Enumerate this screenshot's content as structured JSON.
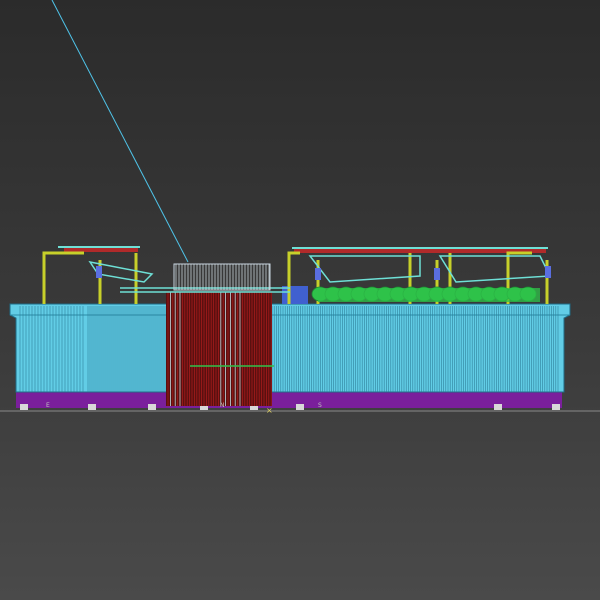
{
  "viewport": {
    "type": "3d-wireframe-viewport"
  },
  "scene_colors": {
    "background_top": "#2b2b2b",
    "background_bottom": "#4a4a4a",
    "grid_line": "#8a8a8a",
    "cable": "#4fc3e8",
    "tank_body": "#62cde6",
    "tank_line": "#1f6c86",
    "base": "#7a1f9c",
    "frame_yellow": "#c7d02a",
    "frame_cyan": "#6ee0d6",
    "rail_red": "#b02a2a",
    "equipment_green": "#2fc24a",
    "center_dark_red": "#8a1414",
    "blue_block": "#4060d0"
  },
  "tank_labels": [
    "E",
    "N",
    "S"
  ]
}
